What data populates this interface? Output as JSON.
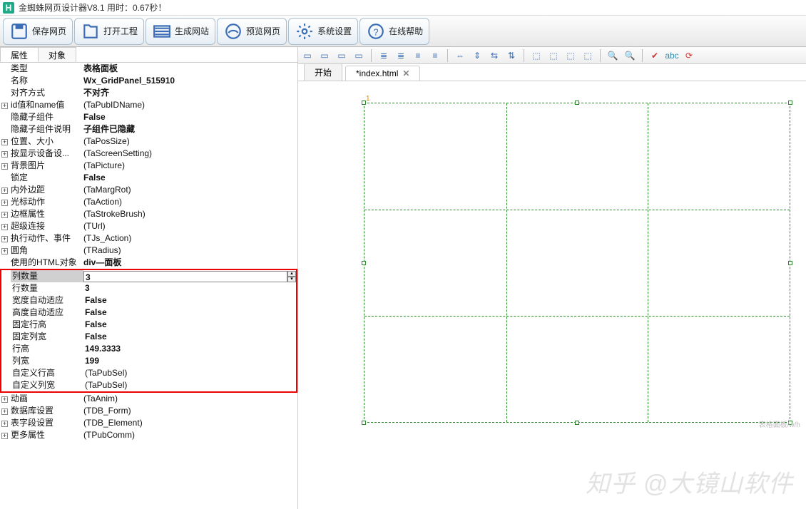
{
  "titlebar": {
    "logo": "H",
    "title": "金蜘蛛网页设计器V8.1 用时：0.67秒！"
  },
  "toolbar": {
    "save": "保存网页",
    "open": "打开工程",
    "build": "生成网站",
    "preview": "预览网页",
    "settings": "系统设置",
    "help": "在线帮助"
  },
  "left_tabs": {
    "properties": "属性",
    "objects": "对象"
  },
  "props": [
    {
      "exp": "",
      "name": "类型",
      "val": "表格面板",
      "bold": true
    },
    {
      "exp": "",
      "name": "名称",
      "val": "Wx_GridPanel_515910",
      "bold": true
    },
    {
      "exp": "",
      "name": "对齐方式",
      "val": "不对齐",
      "bold": true
    },
    {
      "exp": "+",
      "name": "id值和name值",
      "val": "(TaPubIDName)"
    },
    {
      "exp": "",
      "name": "隐藏子组件",
      "val": "False",
      "bold": true
    },
    {
      "exp": "",
      "name": "隐藏子组件说明",
      "val": "子组件已隐藏",
      "bold": true
    },
    {
      "exp": "+",
      "name": "位置、大小",
      "val": "(TaPosSize)"
    },
    {
      "exp": "+",
      "name": "按显示设备设...",
      "val": "(TaScreenSetting)"
    },
    {
      "exp": "+",
      "name": "背景图片",
      "val": "(TaPicture)"
    },
    {
      "exp": "",
      "name": "锁定",
      "val": "False",
      "bold": true
    },
    {
      "exp": "+",
      "name": "内外边距",
      "val": "(TaMargRot)"
    },
    {
      "exp": "+",
      "name": "光标动作",
      "val": "(TaAction)"
    },
    {
      "exp": "+",
      "name": "边框属性",
      "val": "(TaStrokeBrush)"
    },
    {
      "exp": "+",
      "name": "超级连接",
      "val": "(TUrl)"
    },
    {
      "exp": "+",
      "name": "执行动作、事件",
      "val": "(TJs_Action)"
    },
    {
      "exp": "+",
      "name": "圆角",
      "val": "(TRadius)"
    },
    {
      "exp": "",
      "name": "使用的HTML对象",
      "val": "div—面板",
      "bold": true
    },
    {
      "exp": "",
      "name": "列数量",
      "val": "3",
      "bold": true,
      "sel": true
    },
    {
      "exp": "",
      "name": "行数量",
      "val": "3",
      "bold": true
    },
    {
      "exp": "",
      "name": "宽度自动适应",
      "val": "False",
      "bold": true
    },
    {
      "exp": "",
      "name": "高度自动适应",
      "val": "False",
      "bold": true
    },
    {
      "exp": "",
      "name": "固定行高",
      "val": "False",
      "bold": true
    },
    {
      "exp": "",
      "name": "固定列宽",
      "val": "False",
      "bold": true
    },
    {
      "exp": "",
      "name": "行高",
      "val": "149.3333",
      "bold": true
    },
    {
      "exp": "",
      "name": "列宽",
      "val": "199",
      "bold": true
    },
    {
      "exp": "",
      "name": "自定义行高",
      "val": "(TaPubSel)"
    },
    {
      "exp": "",
      "name": "自定义列宽",
      "val": "(TaPubSel)"
    },
    {
      "exp": "+",
      "name": "动画",
      "val": "(TaAnim)"
    },
    {
      "exp": "+",
      "name": "数据库设置",
      "val": "(TDB_Form)"
    },
    {
      "exp": "+",
      "name": "表字段设置",
      "val": "(TDB_Element)"
    },
    {
      "exp": "+",
      "name": "更多属性",
      "val": "(TPubComm)"
    }
  ],
  "doc_tabs": {
    "start": "开始",
    "file": "*index.html"
  },
  "canvas": {
    "marker": "1",
    "corner_label": "表格面板/w/h"
  },
  "watermark": "知乎 @大镜山软件"
}
